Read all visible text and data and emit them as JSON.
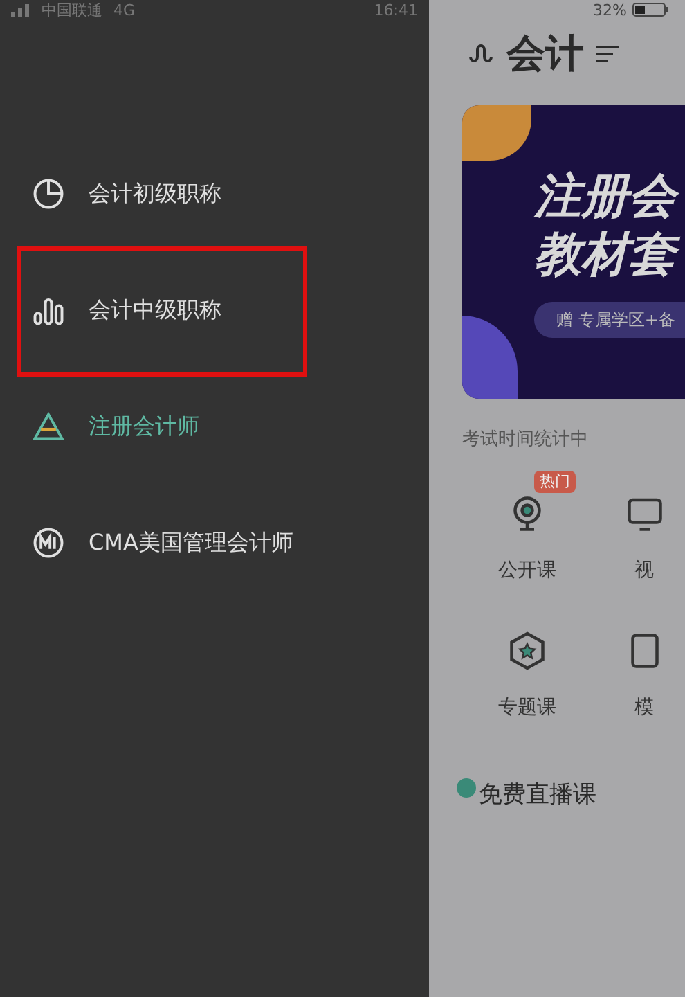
{
  "status_bar": {
    "carrier": "中国联通",
    "network": "4G",
    "time": "16:41",
    "battery": "32%"
  },
  "drawer": {
    "items": [
      {
        "kind": "pie",
        "label": "会计初级职称",
        "selected": false,
        "highlighted": false
      },
      {
        "kind": "bars",
        "label": "会计中级职称",
        "selected": false,
        "highlighted": true
      },
      {
        "kind": "triangle",
        "label": "注册会计师",
        "selected": true,
        "highlighted": false
      },
      {
        "kind": "badge",
        "label": "CMA美国管理会计师",
        "selected": false,
        "highlighted": false
      }
    ]
  },
  "page": {
    "title": "会计",
    "banner": {
      "line_1": "注册会",
      "line_2": "教材套",
      "tag": "赠 专属学区+备"
    },
    "note": "考试时间统计中",
    "shortcuts": [
      {
        "kind": "webcam",
        "label": "公开课",
        "badge": "热门"
      },
      {
        "kind": "screen",
        "label": "视"
      },
      {
        "kind": "hexagon",
        "label": "专题课"
      },
      {
        "kind": "doc",
        "label": "模"
      }
    ],
    "section_title": "免费直播课"
  }
}
